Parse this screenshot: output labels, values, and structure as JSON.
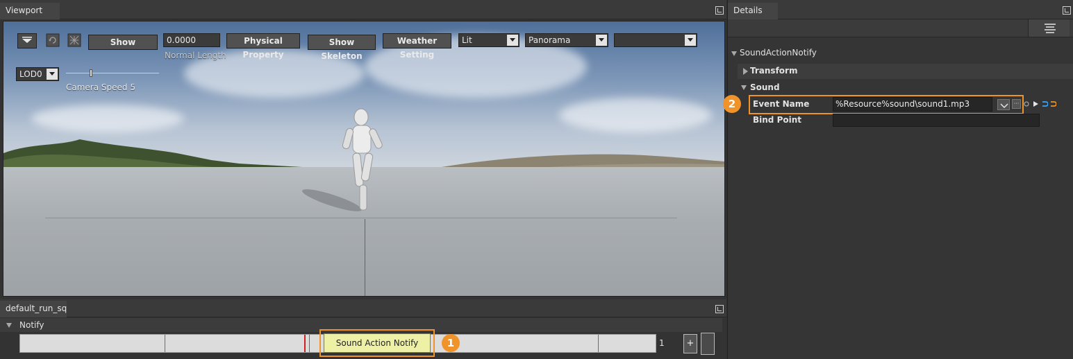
{
  "viewport": {
    "tab_label": "Viewport",
    "toolbar": {
      "show_label": "Show",
      "normal_length_value": "0.0000",
      "normal_length_label": "Normal Length",
      "physical_property_label": "Physical Property",
      "show_skeleton_label": "Show Skeleton",
      "weather_setting_label": "Weather Setting",
      "lit_value": "Lit",
      "panorama_value": "Panorama",
      "third_select_value": "",
      "lod_value": "LOD0",
      "camera_speed_label": "Camera Speed 5"
    }
  },
  "details": {
    "tab_label": "Details",
    "section_title": "SoundActionNotify",
    "transform_label": "Transform",
    "sound_label": "Sound",
    "event_name_label": "Event Name",
    "event_name_value": "%Resource%sound\\sound1.mp3",
    "bind_point_label": "Bind Point",
    "bind_point_value": "",
    "badge_number": "2",
    "browse_label": "···"
  },
  "timeline": {
    "tab_label": "default_run_sq",
    "notify_label": "Notify",
    "notify_event_label": "Sound Action Notify",
    "badge_number": "1",
    "frame_value": "1",
    "add_label": "+"
  },
  "colors": {
    "highlight": "#f0932b",
    "notify_fill": "#eef0a6",
    "playhead": "#d0201c"
  }
}
